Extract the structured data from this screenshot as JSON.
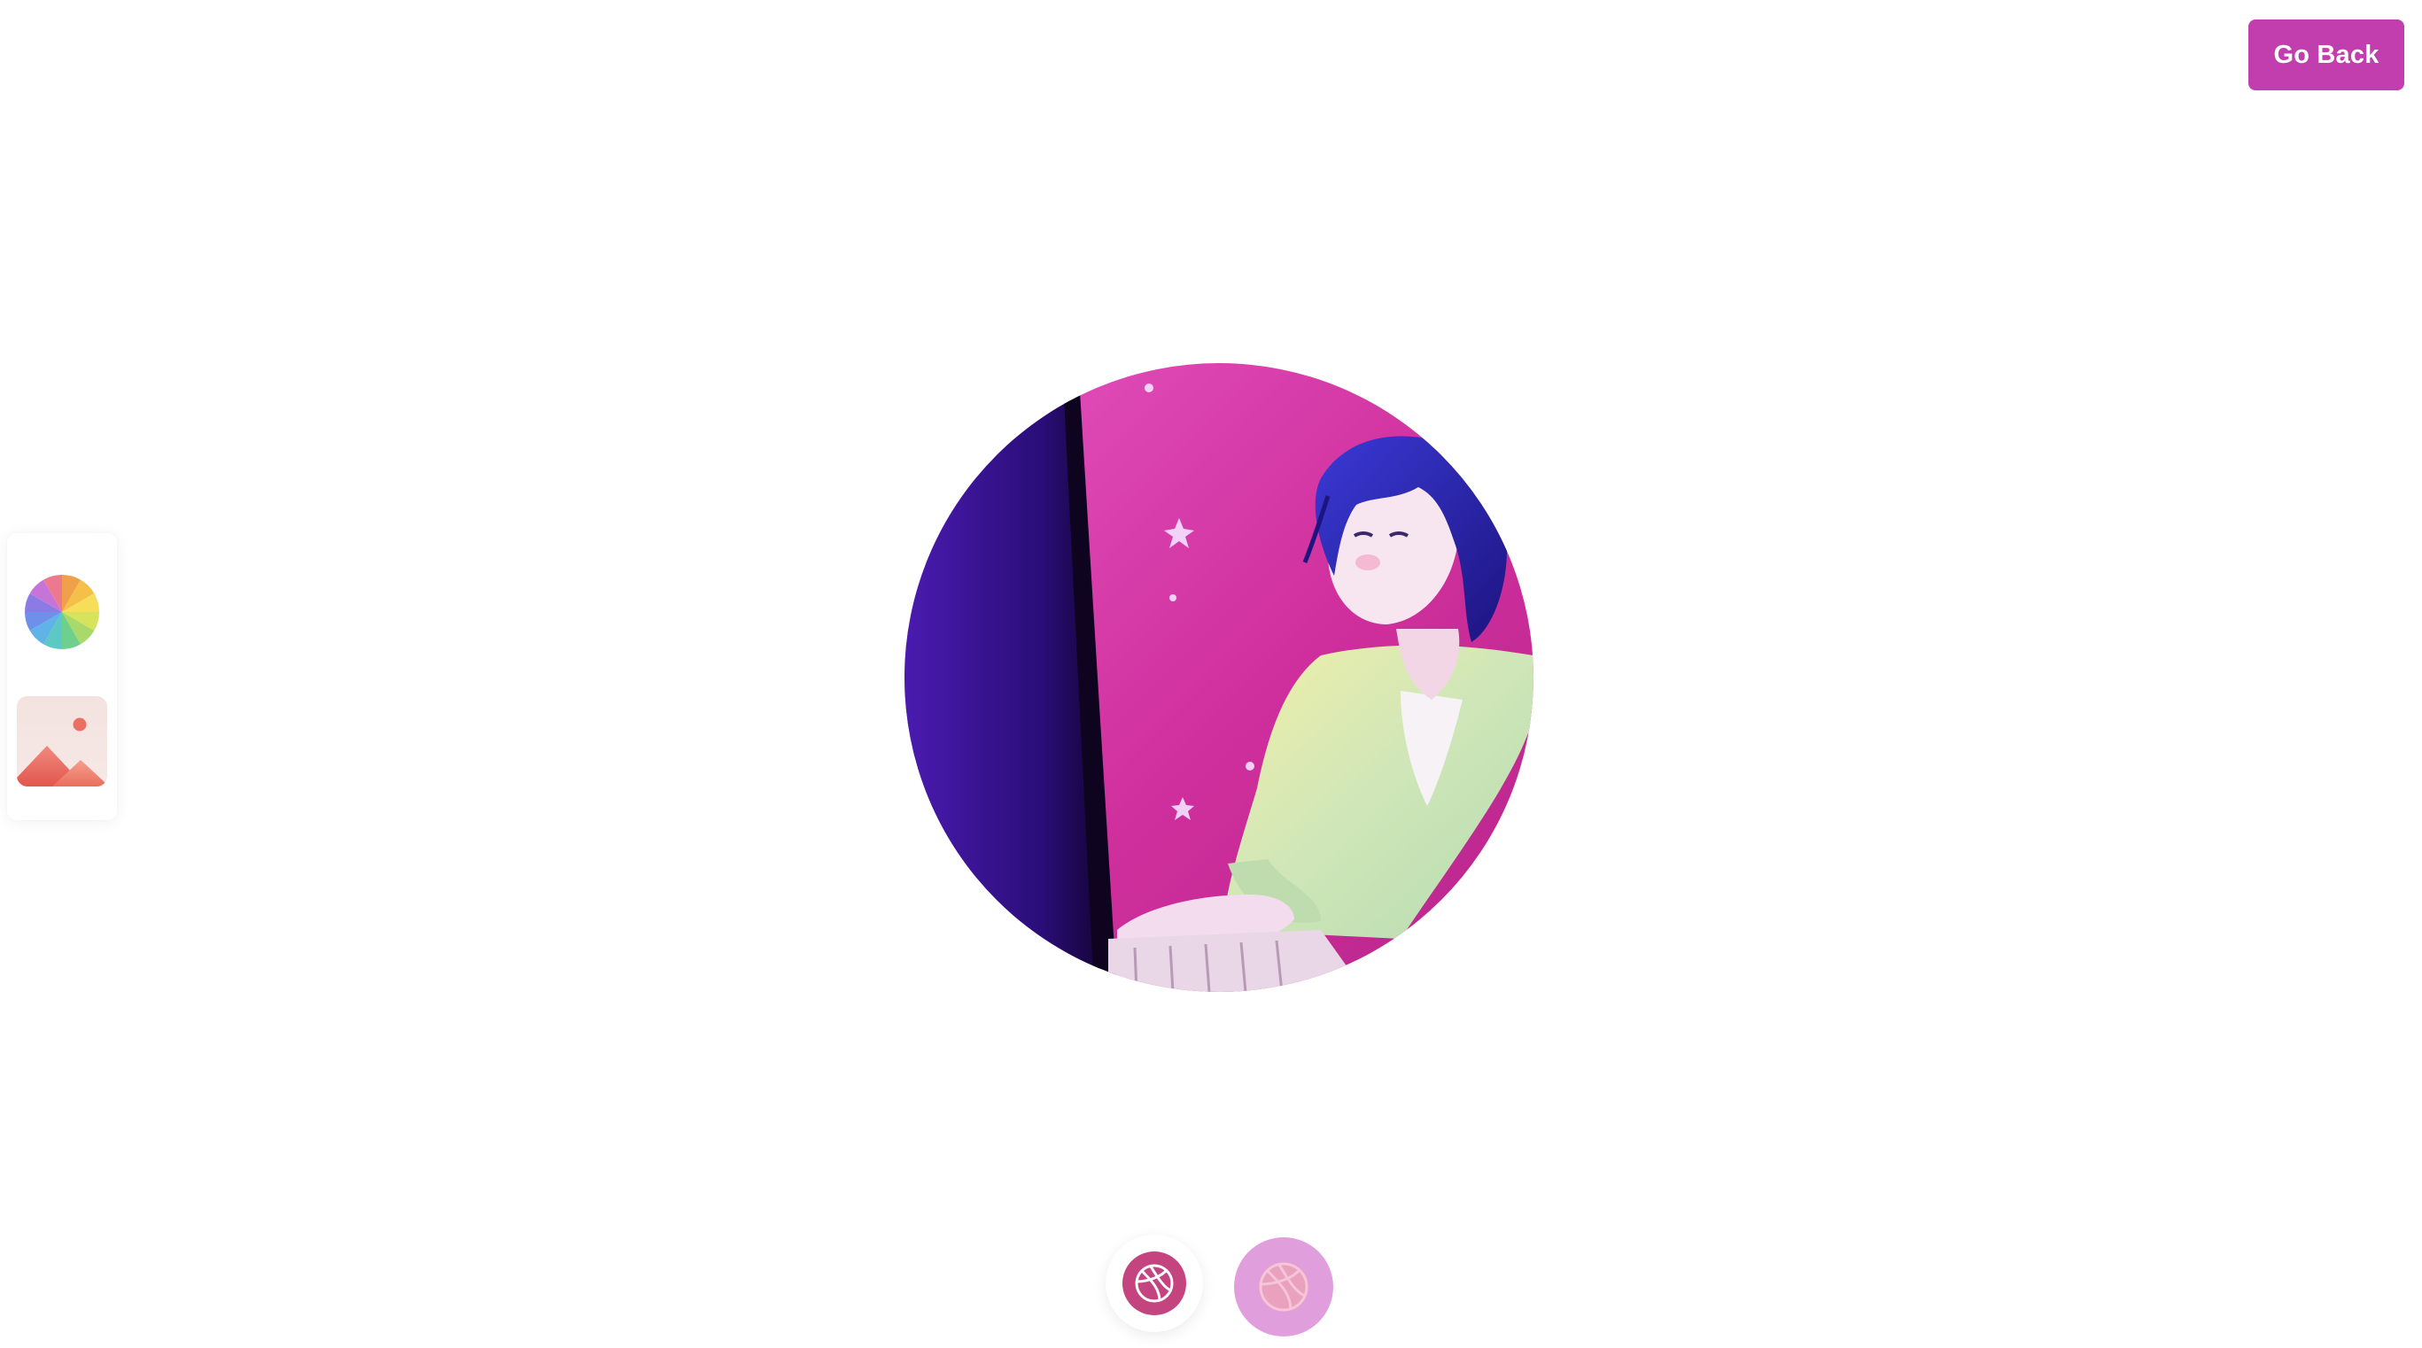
{
  "header": {
    "go_back_label": "Go Back"
  },
  "tools": [
    {
      "name": "color-wheel-icon"
    },
    {
      "name": "image-icon"
    }
  ],
  "avatar": {
    "description_icon": "avatar-image"
  },
  "bottom_controls": [
    {
      "name": "dribbble-icon",
      "state": "selected"
    },
    {
      "name": "dribbble-icon",
      "state": "faded"
    }
  ],
  "colors": {
    "accent": "#c23dae",
    "primary_dot": "#c4447f",
    "secondary_dot": "#e19edd",
    "avatar_magenta": "#d23aa8",
    "avatar_purple": "#3b0f8a"
  }
}
